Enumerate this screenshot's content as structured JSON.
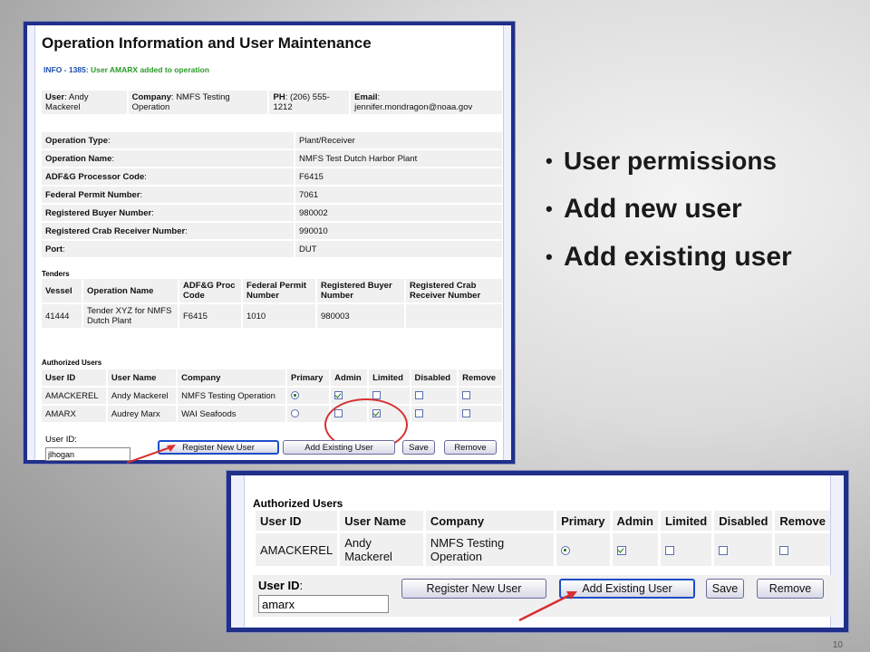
{
  "top": {
    "title": "Operation Information and User Maintenance",
    "info_code": "INFO - 1385:",
    "info_msg": " User AMARX added to operation",
    "user_box": {
      "user_label": "User",
      "user_value": ": Andy Mackerel",
      "company_label": "Company",
      "company_value": ": NMFS Testing Operation",
      "ph_label": "PH",
      "ph_value": ": (206) 555-1212",
      "email_label": "Email",
      "email_value": ": jennifer.mondragon@noaa.gov"
    },
    "operation": [
      {
        "label": "Operation Type",
        "value": "Plant/Receiver"
      },
      {
        "label": "Operation Name",
        "value": "NMFS Test Dutch Harbor Plant"
      },
      {
        "label": "ADF&G Processor Code",
        "value": "F6415"
      },
      {
        "label": "Federal Permit Number",
        "value": "7061"
      },
      {
        "label": "Registered Buyer Number",
        "value": "980002"
      },
      {
        "label": "Registered Crab Receiver Number",
        "value": "990010"
      },
      {
        "label": "Port",
        "value": "DUT"
      }
    ],
    "tenders_title": "Tenders",
    "tenders_headers": [
      "Vessel",
      "Operation Name",
      "ADF&G Proc Code",
      "Federal Permit Number",
      "Registered Buyer Number",
      "Registered Crab Receiver Number"
    ],
    "tenders_row": [
      "41444",
      "Tender XYZ for NMFS Dutch Plant",
      "F6415",
      "1010",
      "980003",
      ""
    ],
    "auth_title": "Authorized Users",
    "auth_headers": [
      "User ID",
      "User Name",
      "Company",
      "Primary",
      "Admin",
      "Limited",
      "Disabled",
      "Remove"
    ],
    "auth_rows": [
      {
        "id": "AMACKEREL",
        "name": "Andy Mackerel",
        "company": "NMFS Testing Operation",
        "primary": true,
        "admin": true,
        "limited": false,
        "disabled": false,
        "remove": false
      },
      {
        "id": "AMARX",
        "name": "Audrey Marx",
        "company": "WAI Seafoods",
        "primary": false,
        "admin": false,
        "limited": true,
        "disabled": false,
        "remove": false
      }
    ],
    "user_id_label": "User ID:",
    "user_id_value": "jlhogan",
    "buttons": {
      "register": "Register New User",
      "add_existing": "Add Existing User",
      "save": "Save",
      "remove": "Remove"
    }
  },
  "zoom": {
    "title": "Authorized Users",
    "headers": [
      "User ID",
      "User Name",
      "Company",
      "Primary",
      "Admin",
      "Limited",
      "Disabled",
      "Remove"
    ],
    "row": {
      "id": "AMACKEREL",
      "name": "Andy Mackerel",
      "company": "NMFS Testing Operation"
    },
    "user_id_label": "User ID",
    "user_id_colon": ":",
    "user_id_value": "amarx",
    "buttons": {
      "register": "Register New User",
      "add_existing": "Add Existing User",
      "save": "Save",
      "remove": "Remove"
    }
  },
  "bullets": [
    "User permissions",
    "Add new user",
    "Add existing user"
  ],
  "slide_number": "10",
  "colors": {
    "frame": "#1f2f8a",
    "info_code": "#1d4fb0",
    "info_msg": "#2a9a2a",
    "annotation_red": "#d83030"
  }
}
